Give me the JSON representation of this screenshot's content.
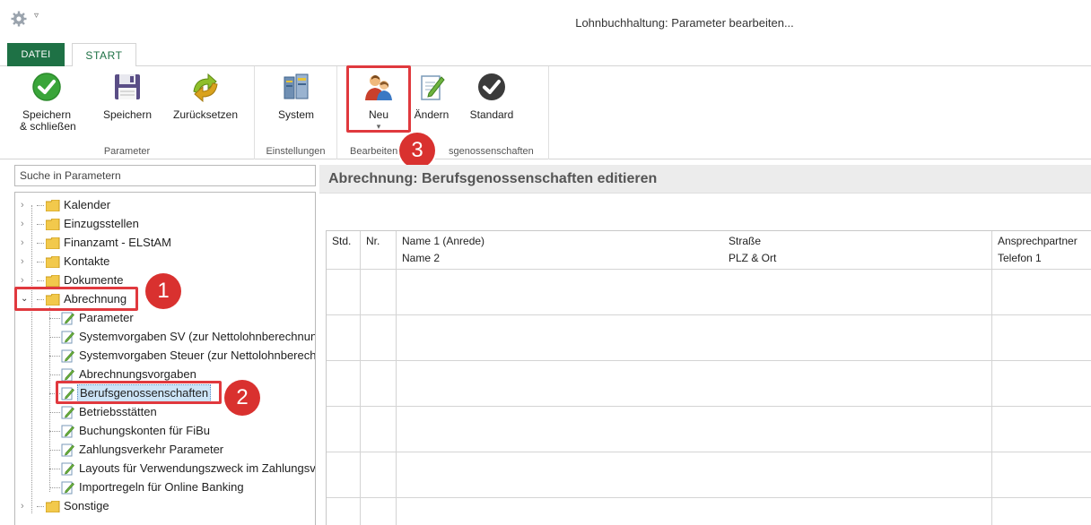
{
  "window": {
    "title": "Lohnbuchhaltung: Parameter bearbeiten...",
    "quick_access_arrow": "▿"
  },
  "tabs": {
    "file": "DATEI",
    "start": "START"
  },
  "ribbon": {
    "groups": {
      "parameter": "Parameter",
      "settings": "Einstellungen",
      "edit": "Bearbeiten",
      "edit_tail": "sgenossenschaften"
    },
    "buttons": {
      "save_close_line1": "Speichern",
      "save_close_line2": "& schließen",
      "save": "Speichern",
      "reset": "Zurücksetzen",
      "system": "System",
      "new": "Neu",
      "new_arrow": "▾",
      "change": "Ändern",
      "standard": "Standard"
    }
  },
  "callouts": {
    "one": "1",
    "two": "2",
    "three": "3"
  },
  "search": {
    "placeholder": "Suche in Parametern"
  },
  "tree": {
    "items": [
      {
        "label": "Kalender"
      },
      {
        "label": "Einzugsstellen"
      },
      {
        "label": "Finanzamt - ELStAM"
      },
      {
        "label": "Kontakte"
      },
      {
        "label": "Dokumente"
      },
      {
        "label": "Abrechnung"
      },
      {
        "label": "Parameter"
      },
      {
        "label": "Systemvorgaben SV (zur Nettolohnberechnung)"
      },
      {
        "label": "Systemvorgaben Steuer (zur Nettolohnberechnung)"
      },
      {
        "label": "Abrechnungsvorgaben"
      },
      {
        "label": "Berufsgenossenschaften"
      },
      {
        "label": "Betriebsstätten"
      },
      {
        "label": "Buchungskonten für FiBu"
      },
      {
        "label": "Zahlungsverkehr Parameter"
      },
      {
        "label": "Layouts für Verwendungszweck im Zahlungsverkehr"
      },
      {
        "label": "Importregeln für Online Banking"
      },
      {
        "label": "Sonstige"
      }
    ]
  },
  "main": {
    "title": "Abrechnung: Berufsgenossenschaften editieren",
    "columns": {
      "std": "Std.",
      "nr": "Nr.",
      "name1": "Name 1 (Anrede)",
      "name2": "Name 2",
      "street": "Straße",
      "plz": "PLZ & Ort",
      "contact": "Ansprechpartner",
      "phone": "Telefon 1"
    }
  },
  "colors": {
    "accent_green": "#1e7145",
    "highlight_red": "#e0393e",
    "badge_red": "#d9312f",
    "selection_blue": "#cce4f7"
  }
}
